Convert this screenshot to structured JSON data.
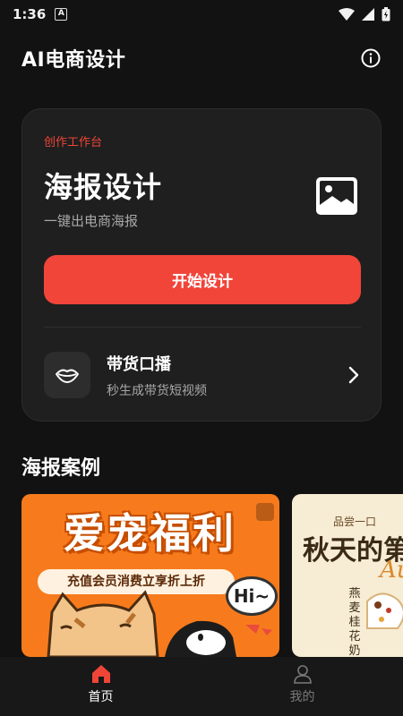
{
  "status_bar": {
    "time": "1:36",
    "notification_badge": "A"
  },
  "header": {
    "title": "AI电商设计"
  },
  "studio": {
    "kicker": "创作工作台",
    "title": "海报设计",
    "subtitle": "一键出电商海报",
    "start_button": "开始设计",
    "live": {
      "title": "带货口播",
      "subtitle": "秒生成带货短视频"
    }
  },
  "cases": {
    "title": "海报案例",
    "items": [
      {
        "headline": "爱宠福利",
        "pill": "充值会员消费立享折上折",
        "bubble": "Hi~"
      },
      {
        "top": "品尝一口",
        "headline": "秋天的第",
        "accent": "Au",
        "vertical": "燕麦桂花奶茶"
      }
    ]
  },
  "nav": {
    "home": "首页",
    "me": "我的"
  },
  "colors": {
    "accent": "#f1453a",
    "background": "#121212",
    "card": "#1f1f1f"
  }
}
